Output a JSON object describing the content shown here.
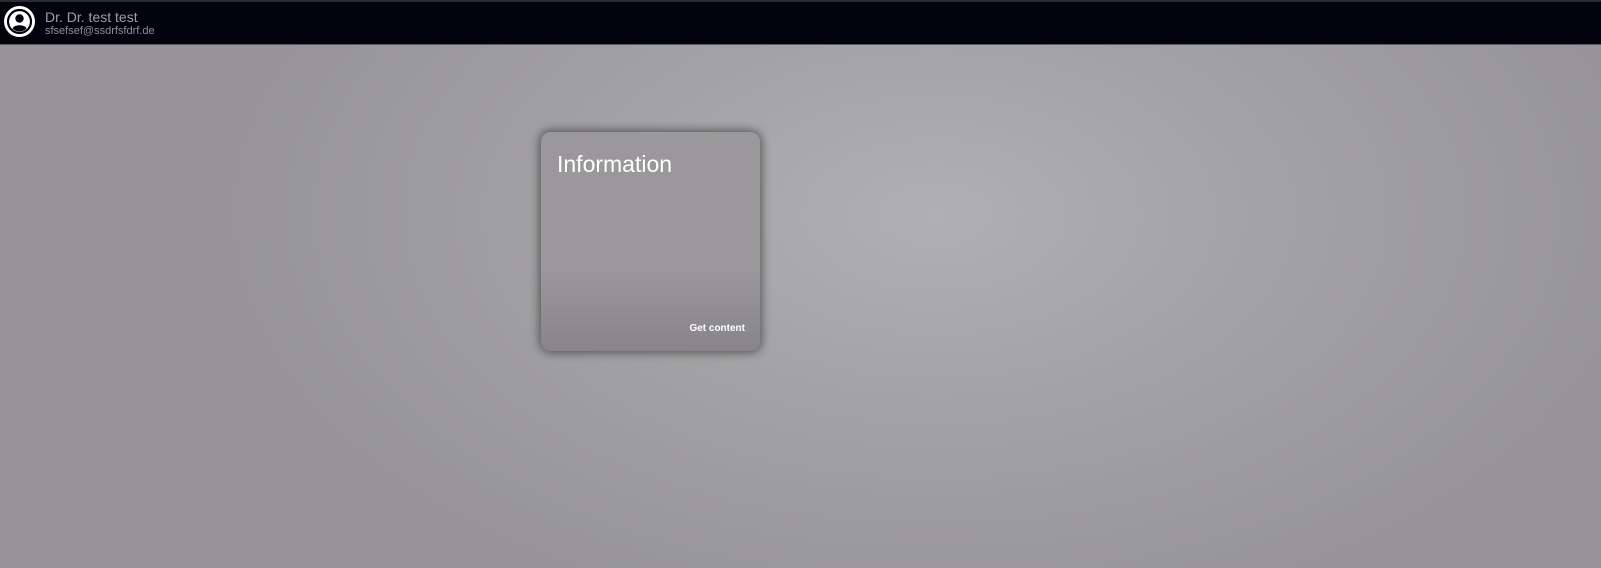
{
  "header": {
    "avatar_icon": "account-circle-icon",
    "user_name": "Dr. Dr. test test",
    "user_email": "sfsefsef@ssdrfsfdrf.de"
  },
  "card": {
    "title": "Information",
    "action_label": "Get content"
  },
  "colors": {
    "topbar": "#03030e",
    "background": "#a3a2a4",
    "card": "#9a989b",
    "text_light": "#ffffff"
  }
}
